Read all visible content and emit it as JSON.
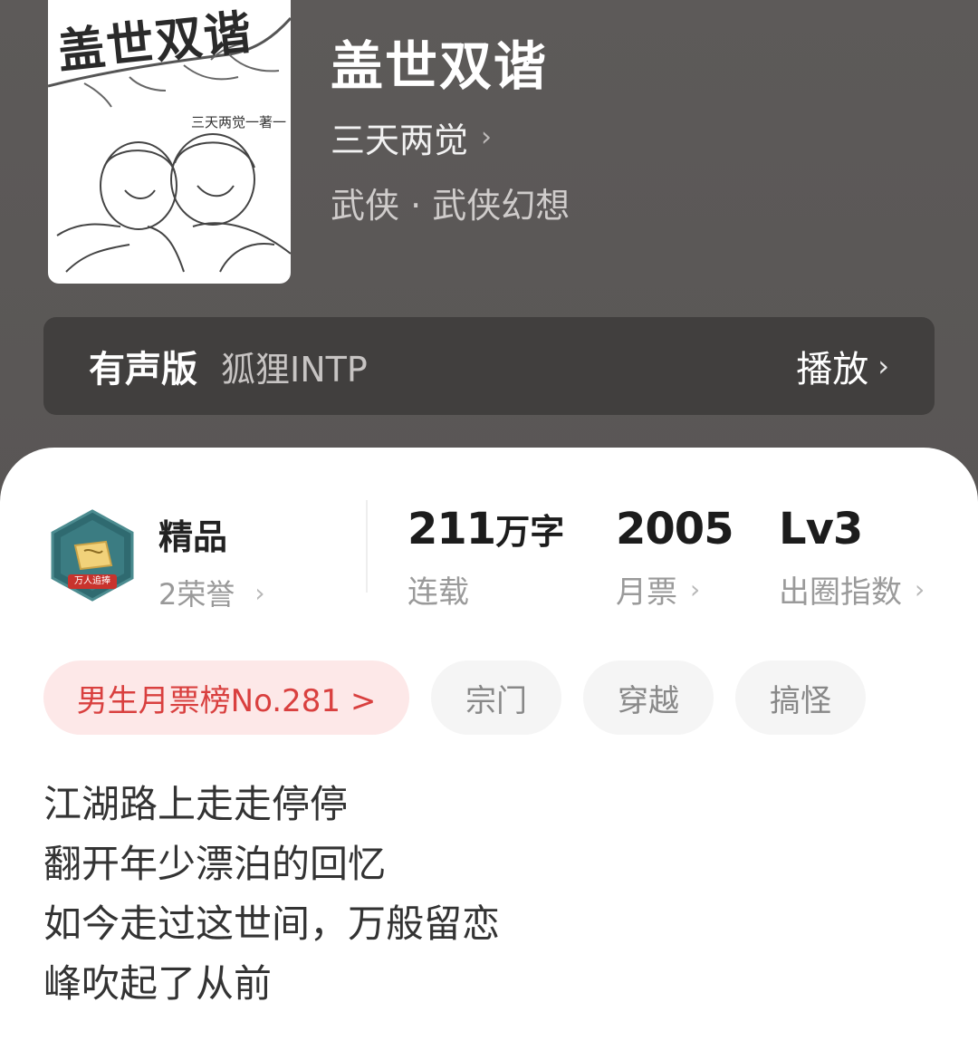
{
  "cover": {
    "title": "盖世双谐",
    "author": "三天两觉一著一"
  },
  "book": {
    "title": "盖世双谐",
    "author": "三天两觉",
    "author_chevron": "›",
    "genre": "武侠 · 武侠幻想"
  },
  "audio": {
    "label": "有声版",
    "narrator": "狐狸INTP",
    "play": "播放",
    "chevron": "›"
  },
  "stats": {
    "badge_banner": "万人追捧",
    "quality": "精品",
    "honors": "2荣誉",
    "words_value": "211",
    "words_unit": "万字",
    "words_label": "连载",
    "monthly_votes_value": "2005",
    "monthly_votes_label": "月票",
    "influence_value": "Lv3",
    "influence_label": "出圈指数",
    "chevron": "›"
  },
  "tags": {
    "rank": "男生月票榜No.281 >",
    "items": [
      "宗门",
      "穿越",
      "搞怪"
    ]
  },
  "description": [
    "江湖路上走走停停",
    "翻开年少漂泊的回忆",
    "如今走过这世间，万般留恋",
    "峰吹起了从前"
  ],
  "colors": {
    "header_bg": "#5b5857",
    "audio_bar": "#413f3e",
    "rank_tag_bg": "#fde8e8",
    "rank_tag_text": "#d9403f",
    "tag_bg": "#f5f5f5",
    "badge_teal": "#2f6a70",
    "badge_red": "#c8332d"
  }
}
